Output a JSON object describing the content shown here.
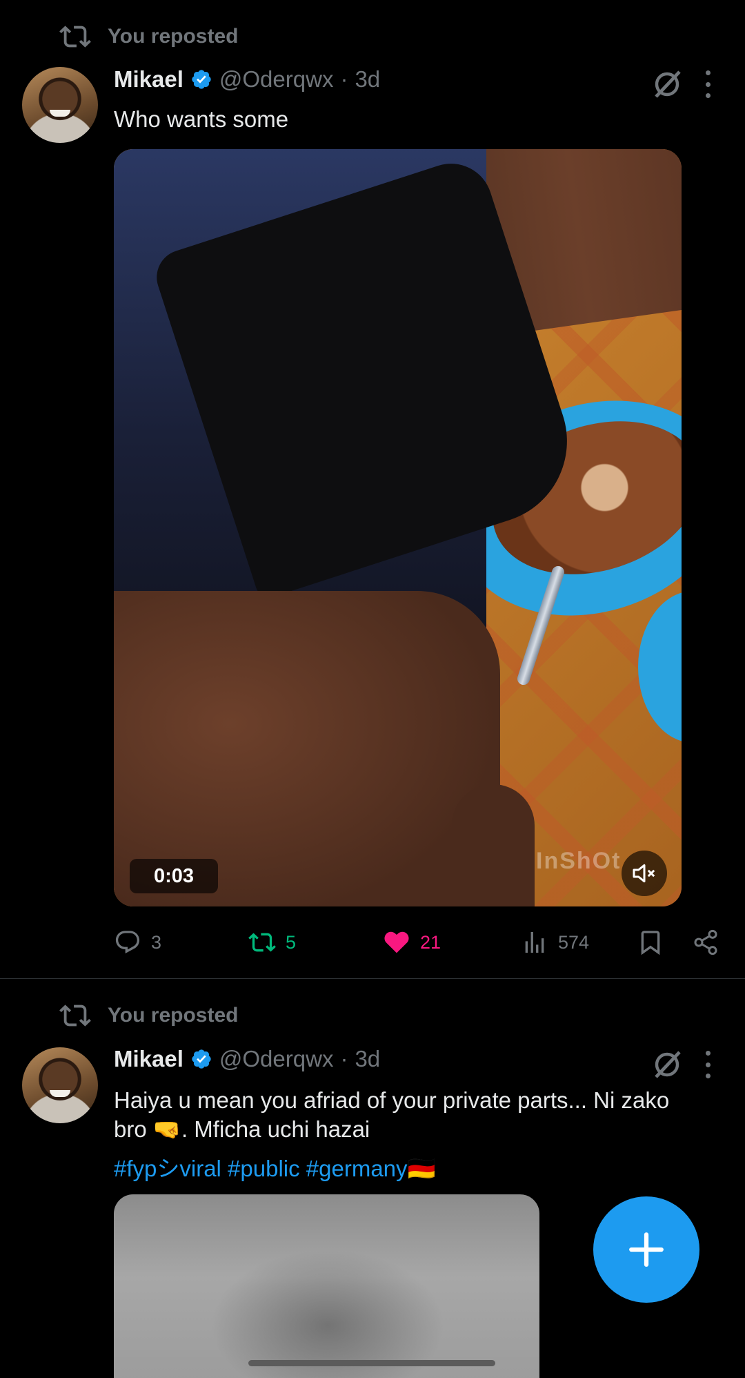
{
  "posts": [
    {
      "repost_label": "You reposted",
      "author": {
        "name": "Mikael",
        "handle": "@Oderqwx",
        "time": "3d",
        "separator": "·",
        "verified": true
      },
      "text": "Who wants some",
      "video": {
        "duration": "0:03",
        "watermark": "InShOt",
        "muted": true
      },
      "metrics": {
        "replies": "3",
        "reposts": "5",
        "likes": "21",
        "views": "574",
        "reposted": true,
        "liked": true
      }
    },
    {
      "repost_label": "You reposted",
      "author": {
        "name": "Mikael",
        "handle": "@Oderqwx",
        "time": "3d",
        "separator": "·",
        "verified": true
      },
      "text_line1": "Haiya u mean you afriad of your private parts... Ni zako",
      "text_line2": "bro 🤜. Mficha uchi hazai",
      "hashtags": "#fypシviral #public #germany🇩🇪"
    }
  ],
  "icons": {
    "repost": "repost-icon",
    "verified": "verified-badge-icon",
    "grok": "grok-icon",
    "more": "more-icon",
    "reply": "reply-icon",
    "like": "heart-icon",
    "views": "views-icon",
    "bookmark": "bookmark-icon",
    "share": "share-icon",
    "mute": "mute-icon",
    "compose": "plus-icon"
  },
  "colors": {
    "accent": "#1d9bf0",
    "repost_active": "#00ba7c",
    "like_active": "#f91880",
    "muted_text": "#71767b",
    "background": "#000000"
  }
}
